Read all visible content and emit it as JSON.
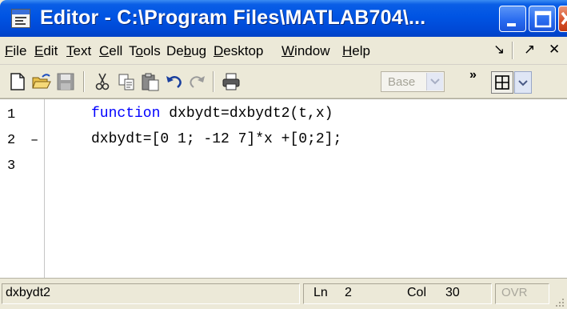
{
  "window": {
    "title": "Editor - C:\\Program Files\\MATLAB704\\...",
    "app_icon": "editor-document-icon",
    "controls": [
      "minimize-icon",
      "maximize-icon",
      "close-icon"
    ]
  },
  "menubar": {
    "items": [
      {
        "pre": "",
        "u": "F",
        "post": "ile"
      },
      {
        "pre": "",
        "u": "E",
        "post": "dit"
      },
      {
        "pre": "",
        "u": "T",
        "post": "ext"
      },
      {
        "pre": "",
        "u": "C",
        "post": "ell"
      },
      {
        "pre": "T",
        "u": "o",
        "post": "ols"
      },
      {
        "pre": "De",
        "u": "b",
        "post": "ug"
      },
      {
        "pre": "",
        "u": "D",
        "post": "esktop"
      },
      {
        "pre": "",
        "u": "W",
        "post": "indow"
      },
      {
        "pre": "",
        "u": "H",
        "post": "elp"
      }
    ],
    "dock_arrow": "↘",
    "undock_arrow": "↗",
    "close_mark": "✕"
  },
  "toolbar": {
    "icons": [
      "new-file-icon",
      "open-folder-icon",
      "save-icon",
      "cut-icon",
      "copy-icon",
      "paste-icon",
      "undo-icon",
      "redo-icon",
      "print-icon"
    ],
    "base_select": "Base",
    "overflow": "»",
    "layout_icon": "tile-layout-icon"
  },
  "editor": {
    "lines": [
      {
        "num": "1",
        "mark": "",
        "keyword": "function",
        "rest": " dxbydt=dxbydt2(t,x)"
      },
      {
        "num": "2",
        "mark": "–",
        "keyword": "",
        "rest": "dxbydt=[0 1; -12 7]*x +[0;2];"
      },
      {
        "num": "3",
        "mark": "",
        "keyword": "",
        "rest": ""
      }
    ],
    "keyword_color": "#0000ff"
  },
  "statusbar": {
    "function_name": "dxbydt2",
    "ln_label": "Ln",
    "ln_value": "2",
    "col_label": "Col",
    "col_value": "30",
    "ovr": "OVR"
  }
}
